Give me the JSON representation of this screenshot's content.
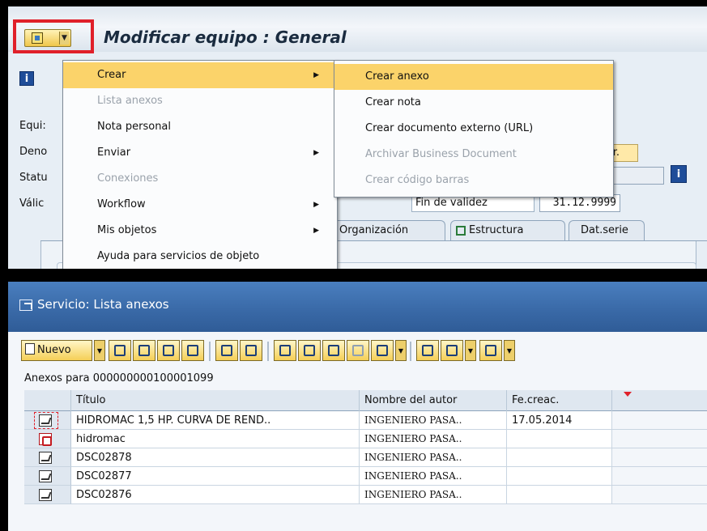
{
  "top": {
    "window_title": "Modificar equipo : General",
    "labels": [
      "Equi:",
      "Deno",
      "Statu",
      "Válic"
    ],
    "ctr_button": "ıtr.",
    "fin_label": "Fin de validez",
    "fin_value": "31.12.9999",
    "tabs": [
      "Organización",
      "Estructura",
      "Dat.serie"
    ]
  },
  "menu": {
    "items": [
      {
        "label": "Crear",
        "submenu": true,
        "highlighted": true,
        "disabled": false
      },
      {
        "label": "Lista anexos",
        "submenu": false,
        "disabled": true
      },
      {
        "label": "Nota personal",
        "submenu": false,
        "disabled": false
      },
      {
        "label": "Enviar",
        "submenu": true,
        "disabled": false
      },
      {
        "label": "Conexiones",
        "submenu": false,
        "disabled": true
      },
      {
        "label": "Workflow",
        "submenu": true,
        "disabled": false
      },
      {
        "label": "Mis objetos",
        "submenu": true,
        "disabled": false
      },
      {
        "label": "Ayuda para servicios de objeto",
        "submenu": false,
        "disabled": false
      }
    ],
    "submenu_marker": "▶"
  },
  "submenu": {
    "items": [
      {
        "label": "Crear anexo",
        "highlighted": true,
        "disabled": false
      },
      {
        "label": "Crear nota",
        "disabled": false
      },
      {
        "label": "Crear documento externo (URL)",
        "disabled": false
      },
      {
        "label": "Archivar Business Document",
        "disabled": true
      },
      {
        "label": "Crear código barras",
        "disabled": true
      }
    ]
  },
  "dialog": {
    "title": "Servicio: Lista anexos",
    "toolbar": {
      "nuevo_label": "Nuevo",
      "icons": [
        "dropdown-icon",
        "link-icon",
        "copy-icon",
        "edit-icon",
        "delete-icon",
        "refresh-icon",
        "display-icon",
        "print-icon",
        "filter-icon",
        "find-icon",
        "find-next-icon",
        "filter-icon",
        "layout-icon",
        "export-icon",
        "grid-icon"
      ]
    },
    "attachments_label": "Anexos para 000000000100001099",
    "columns": [
      "Título",
      "Nombre del autor",
      "Fe.creac."
    ],
    "rows": [
      {
        "icon": "edit-doc-icon",
        "title": "HIDROMAC 1,5 HP. CURVA DE REND..",
        "author": "INGENIERO PASA..",
        "date": "17.05.2014"
      },
      {
        "icon": "pdf-icon",
        "title": "hidromac",
        "author": "INGENIERO PASA..",
        "date": ""
      },
      {
        "icon": "edit-doc-icon",
        "title": "DSC02878",
        "author": "INGENIERO PASA..",
        "date": ""
      },
      {
        "icon": "edit-doc-icon",
        "title": "DSC02877",
        "author": "INGENIERO PASA..",
        "date": ""
      },
      {
        "icon": "edit-doc-icon",
        "title": "DSC02876",
        "author": "INGENIERO PASA..",
        "date": ""
      }
    ]
  },
  "colors": {
    "highlight": "#fbd36a",
    "alert_frame": "#e0202a",
    "dialog_title": "#3a6aa8"
  }
}
